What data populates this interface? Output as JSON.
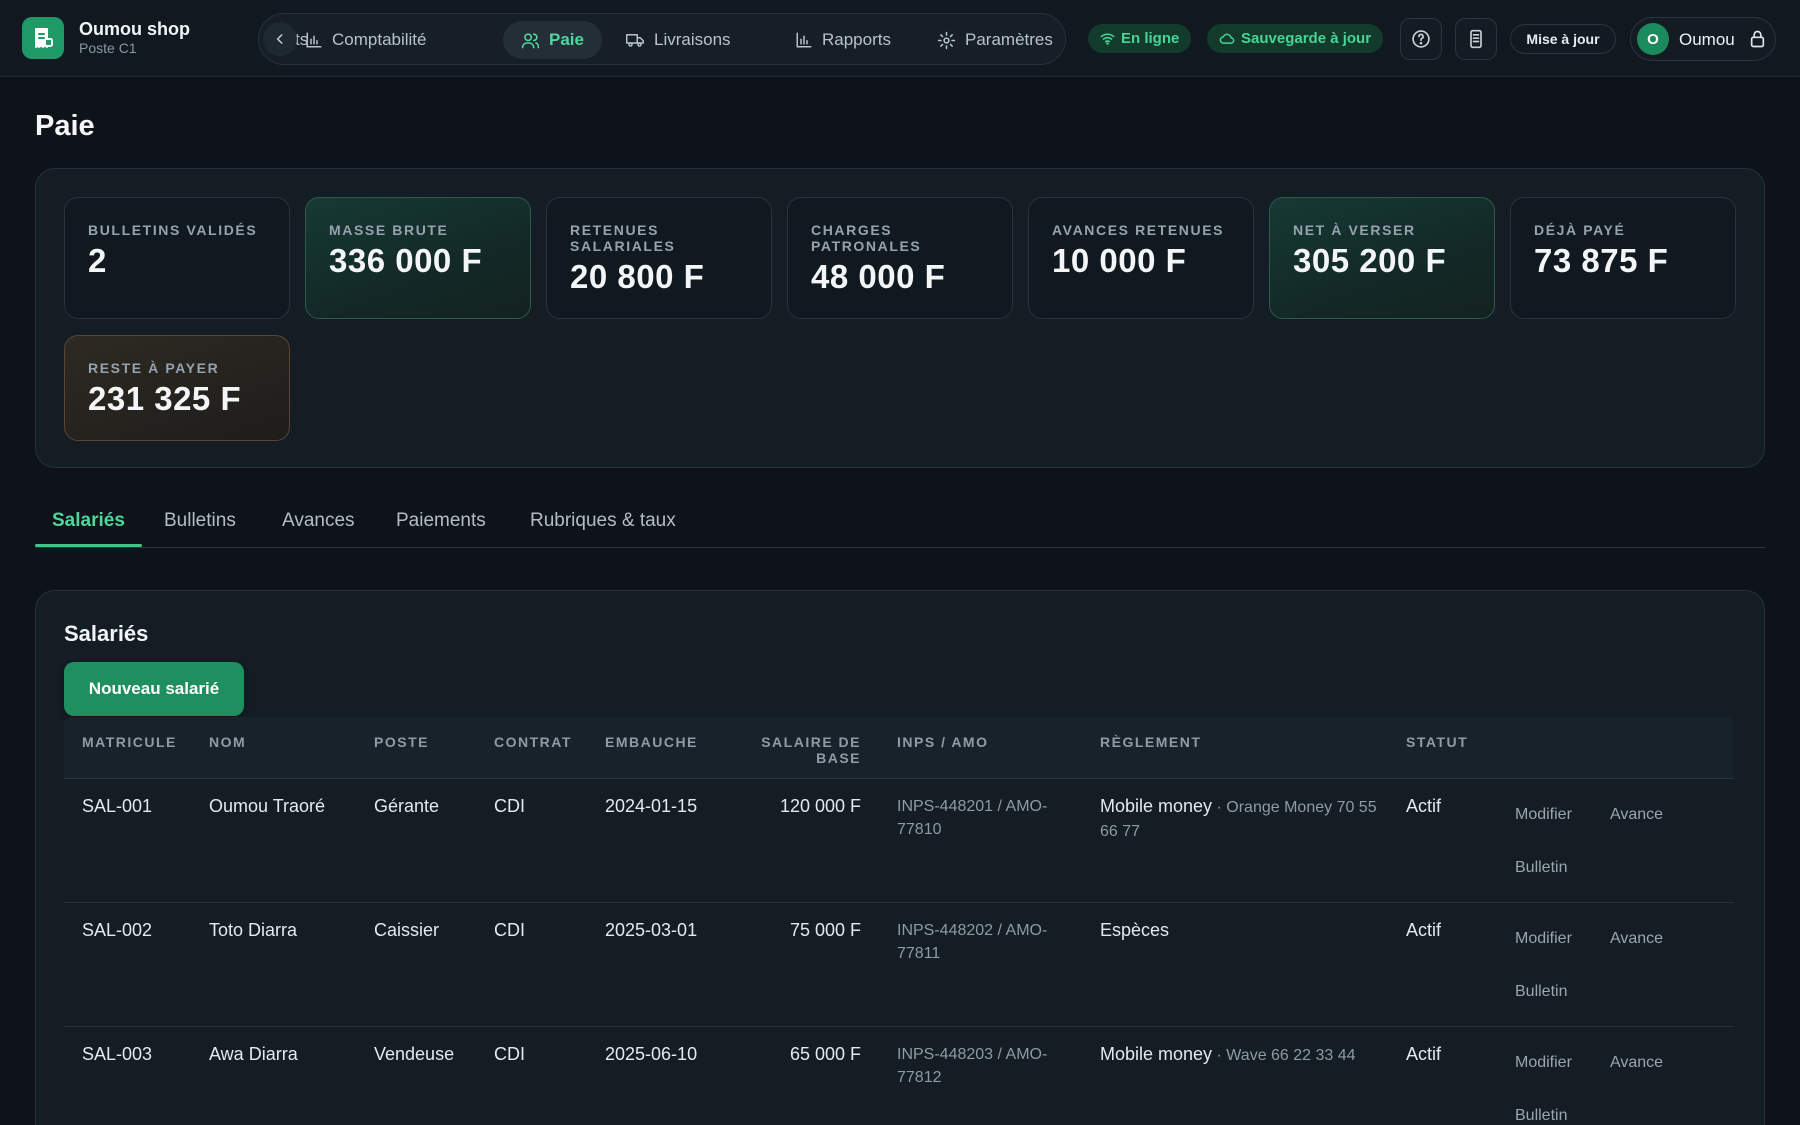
{
  "brand": {
    "name": "Oumou shop",
    "sub": "Poste C1"
  },
  "nav": {
    "partial_label": "ts",
    "items": [
      {
        "label": "Comptabilité",
        "icon": "bar-chart-icon"
      },
      {
        "label": "Paie",
        "icon": "users-icon",
        "active": true
      },
      {
        "label": "Livraisons",
        "icon": "truck-icon"
      },
      {
        "label": "Rapports",
        "icon": "bar-chart-icon"
      },
      {
        "label": "Paramètres",
        "icon": "gear-icon"
      }
    ]
  },
  "status": {
    "online": "En ligne",
    "backup": "Sauvegarde à jour"
  },
  "header_actions": {
    "update": "Mise à jour"
  },
  "user": {
    "initial": "O",
    "name": "Oumou"
  },
  "page": {
    "title": "Paie"
  },
  "stats": [
    {
      "label": "Bulletins validés",
      "value": "2"
    },
    {
      "label": "Masse brute",
      "value": "336 000 F"
    },
    {
      "label": "Retenues salariales",
      "value": "20 800 F"
    },
    {
      "label": "Charges patronales",
      "value": "48 000 F"
    },
    {
      "label": "Avances retenues",
      "value": "10 000 F"
    },
    {
      "label": "Net à verser",
      "value": "305 200 F"
    },
    {
      "label": "Déjà payé",
      "value": "73 875 F"
    },
    {
      "label": "Reste à payer",
      "value": "231 325 F"
    }
  ],
  "tabs": [
    "Salariés",
    "Bulletins",
    "Avances",
    "Paiements",
    "Rubriques & taux"
  ],
  "table": {
    "title": "Salariés",
    "new_button": "Nouveau salarié",
    "headers": [
      "Matricule",
      "Nom",
      "Poste",
      "Contrat",
      "Embauche",
      "Salaire de base",
      "INPS / AMO",
      "Règlement",
      "Statut"
    ],
    "rows": [
      {
        "matricule": "SAL-001",
        "nom": "Oumou Traoré",
        "poste": "Gérante",
        "contrat": "CDI",
        "embauche": "2024-01-15",
        "salaire": "120 000 F",
        "inps": "INPS-448201 / AMO-77810",
        "reglement": "Mobile money",
        "reglement_detail": " · Orange Money 70 55 66 77",
        "statut": "Actif"
      },
      {
        "matricule": "SAL-002",
        "nom": "Toto Diarra",
        "poste": "Caissier",
        "contrat": "CDI",
        "embauche": "2025-03-01",
        "salaire": "75 000 F",
        "inps": "INPS-448202 / AMO-77811",
        "reglement": "Espèces",
        "reglement_detail": "",
        "statut": "Actif"
      },
      {
        "matricule": "SAL-003",
        "nom": "Awa Diarra",
        "poste": "Vendeuse",
        "contrat": "CDI",
        "embauche": "2025-06-10",
        "salaire": "65 000 F",
        "inps": "INPS-448203 / AMO-77812",
        "reglement": "Mobile money",
        "reglement_detail": " · Wave 66 22 33 44",
        "statut": "Actif"
      }
    ],
    "actions": {
      "edit": "Modifier",
      "advance": "Avance",
      "payslip": "Bulletin"
    }
  },
  "colors": {
    "accent": "#4fd69c",
    "primary_button": "#1f8f60",
    "background": "#0d1319"
  }
}
